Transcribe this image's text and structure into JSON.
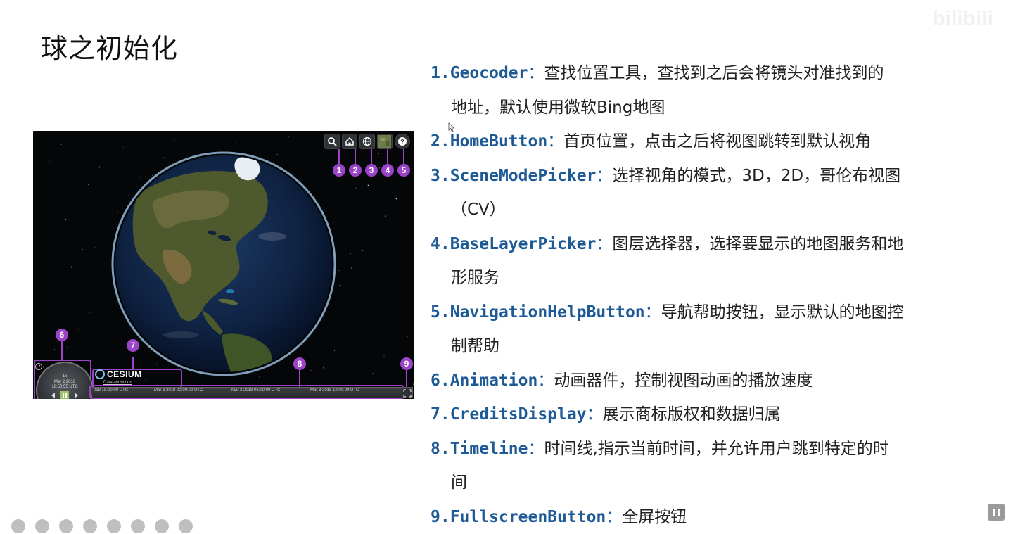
{
  "slide": {
    "title": "球之初始化"
  },
  "watermark": {
    "text": "bilibili"
  },
  "viewer": {
    "toolbar": [
      {
        "icon": "search-icon",
        "badge": "1"
      },
      {
        "icon": "home-icon",
        "badge": "2"
      },
      {
        "icon": "globe-icon",
        "badge": "3"
      },
      {
        "icon": "layers-icon",
        "badge": "4"
      },
      {
        "icon": "help-icon",
        "badge": "5"
      }
    ],
    "badges": {
      "six": "6",
      "seven": "7",
      "eight": "8",
      "nine": "9"
    },
    "animation": {
      "speed": "1x",
      "date": "Mar 2 2018",
      "time": "18:50:55 UTC"
    },
    "credits": {
      "logo": "CESIUM",
      "attribution": "Data attribution"
    },
    "timeline": {
      "ticks": [
        "018 18:00:00 UTC",
        "Mar 3 2018 00:00:00 UTC",
        "Mar 3 2018 06:00:00 UTC",
        "Mar 3 2018 12:00:00 UTC"
      ]
    },
    "colors": {
      "badge": "#9b44c9",
      "accent": "#1e5a96"
    }
  },
  "items": [
    {
      "num": "1.",
      "name": "Geocoder",
      "colon": "：",
      "desc": "查找位置工具，查找到之后会将镜头对准找到的",
      "cont": "地址，默认使用微软Bing地图"
    },
    {
      "num": "2.",
      "name": "HomeButton",
      "colon": "：",
      "desc": "首页位置，点击之后将视图跳转到默认视角",
      "cont": ""
    },
    {
      "num": "3.",
      "name": "SceneModePicker",
      "colon": "：",
      "desc": "选择视角的模式，3D，2D，哥伦布视图",
      "cont": "（CV）"
    },
    {
      "num": "4.",
      "name": "BaseLayerPicker",
      "colon": "：",
      "desc": "图层选择器，选择要显示的地图服务和地",
      "cont": "形服务"
    },
    {
      "num": "5.",
      "name": "NavigationHelpButton",
      "colon": "：",
      "desc": "导航帮助按钮，显示默认的地图控",
      "cont": "制帮助"
    },
    {
      "num": "6.",
      "name": "Animation",
      "colon": "：",
      "desc": "动画器件，控制视图动画的播放速度",
      "cont": ""
    },
    {
      "num": "7.",
      "name": "CreditsDisplay",
      "colon": "：",
      "desc": "展示商标版权和数据归属",
      "cont": ""
    },
    {
      "num": "8.",
      "name": "Timeline",
      "colon": "：",
      "desc": "时间线,指示当前时间，并允许用户跳到特定的时",
      "cont": "间"
    },
    {
      "num": "9.",
      "name": "FullscreenButton",
      "colon": "：",
      "desc": "全屏按钮",
      "cont": ""
    }
  ]
}
